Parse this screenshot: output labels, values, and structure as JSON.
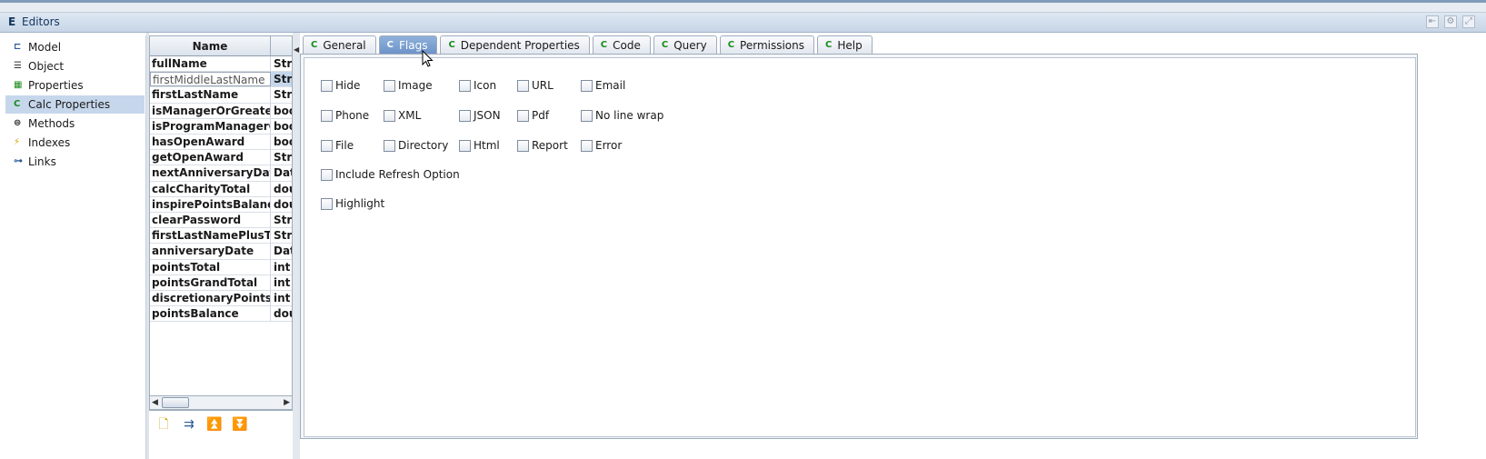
{
  "window": {
    "title": "Editors",
    "title_icon": "E",
    "controls": [
      "restore-icon",
      "settings-icon",
      "maximize-icon"
    ]
  },
  "nav": {
    "items": [
      {
        "label": "Model",
        "icon": "model-icon"
      },
      {
        "label": "Object",
        "icon": "object-icon"
      },
      {
        "label": "Properties",
        "icon": "properties-icon"
      },
      {
        "label": "Calc Properties",
        "icon": "calc-properties-icon",
        "selected": true
      },
      {
        "label": "Methods",
        "icon": "methods-icon"
      },
      {
        "label": "Indexes",
        "icon": "indexes-icon"
      },
      {
        "label": "Links",
        "icon": "links-icon"
      }
    ]
  },
  "table": {
    "columns": [
      "Name",
      ""
    ],
    "rows": [
      {
        "name": "fullName",
        "type": "Strii"
      },
      {
        "name": "firstMiddleLastName",
        "type": "Strii",
        "editing": true
      },
      {
        "name": "firstLastName",
        "type": "Strii"
      },
      {
        "name": "isManagerOrGreater",
        "type": "boo"
      },
      {
        "name": "isProgramManagerOr...",
        "type": "boo"
      },
      {
        "name": "hasOpenAward",
        "type": "boo"
      },
      {
        "name": "getOpenAward",
        "type": "Strii"
      },
      {
        "name": "nextAnniversaryDate",
        "type": "Date"
      },
      {
        "name": "calcCharityTotal",
        "type": "dou"
      },
      {
        "name": "inspirePointsBalance",
        "type": "dou"
      },
      {
        "name": "clearPassword",
        "type": "Strii"
      },
      {
        "name": "firstLastNamePlusTo...",
        "type": "Strii"
      },
      {
        "name": "anniversaryDate",
        "type": "Date"
      },
      {
        "name": "pointsTotal",
        "type": "int"
      },
      {
        "name": "pointsGrandTotal",
        "type": "int"
      },
      {
        "name": "discretionaryPoints",
        "type": "int"
      },
      {
        "name": "pointsBalance",
        "type": "dou"
      }
    ]
  },
  "toolbar": {
    "buttons": [
      "new-icon",
      "insert-icon",
      "move-up-icon",
      "move-down-icon"
    ]
  },
  "tabs": [
    {
      "label": "General"
    },
    {
      "label": "Flags",
      "active": true
    },
    {
      "label": "Dependent Properties"
    },
    {
      "label": "Code"
    },
    {
      "label": "Query"
    },
    {
      "label": "Permissions"
    },
    {
      "label": "Help"
    }
  ],
  "flags": {
    "row1": [
      "Hide",
      "Image",
      "Icon",
      "URL",
      "Email"
    ],
    "row2": [
      "Phone",
      "XML",
      "JSON",
      "Pdf",
      "No line wrap"
    ],
    "row3": [
      "File",
      "Directory",
      "Html",
      "Report",
      "Error"
    ],
    "row4": [
      "Include Refresh Option"
    ],
    "row5": [
      "Highlight"
    ]
  }
}
